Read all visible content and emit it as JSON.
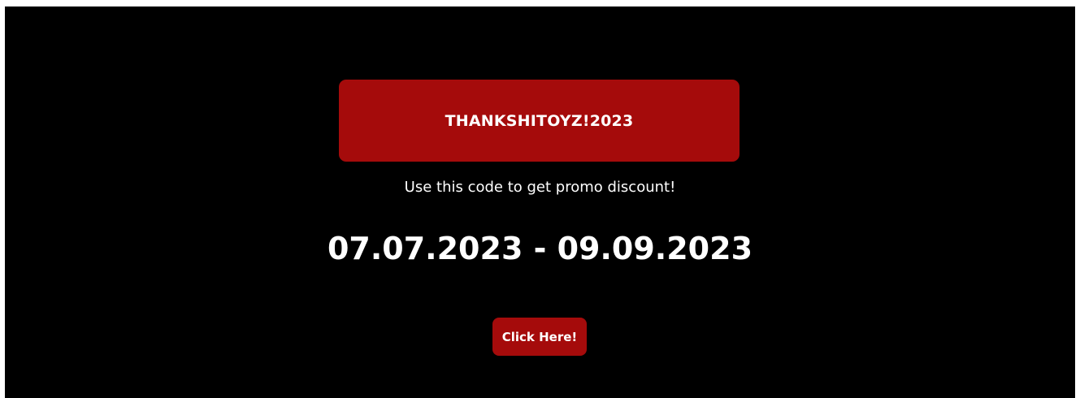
{
  "promo": {
    "code": "THANKSHITOYZ!2023",
    "description": "Use this code to get promo discount!",
    "date_range": "07.07.2023 - 09.09.2023",
    "button_label": "Click Here!"
  },
  "colors": {
    "background": "#000000",
    "accent": "#a50b0b",
    "text": "#ffffff"
  }
}
